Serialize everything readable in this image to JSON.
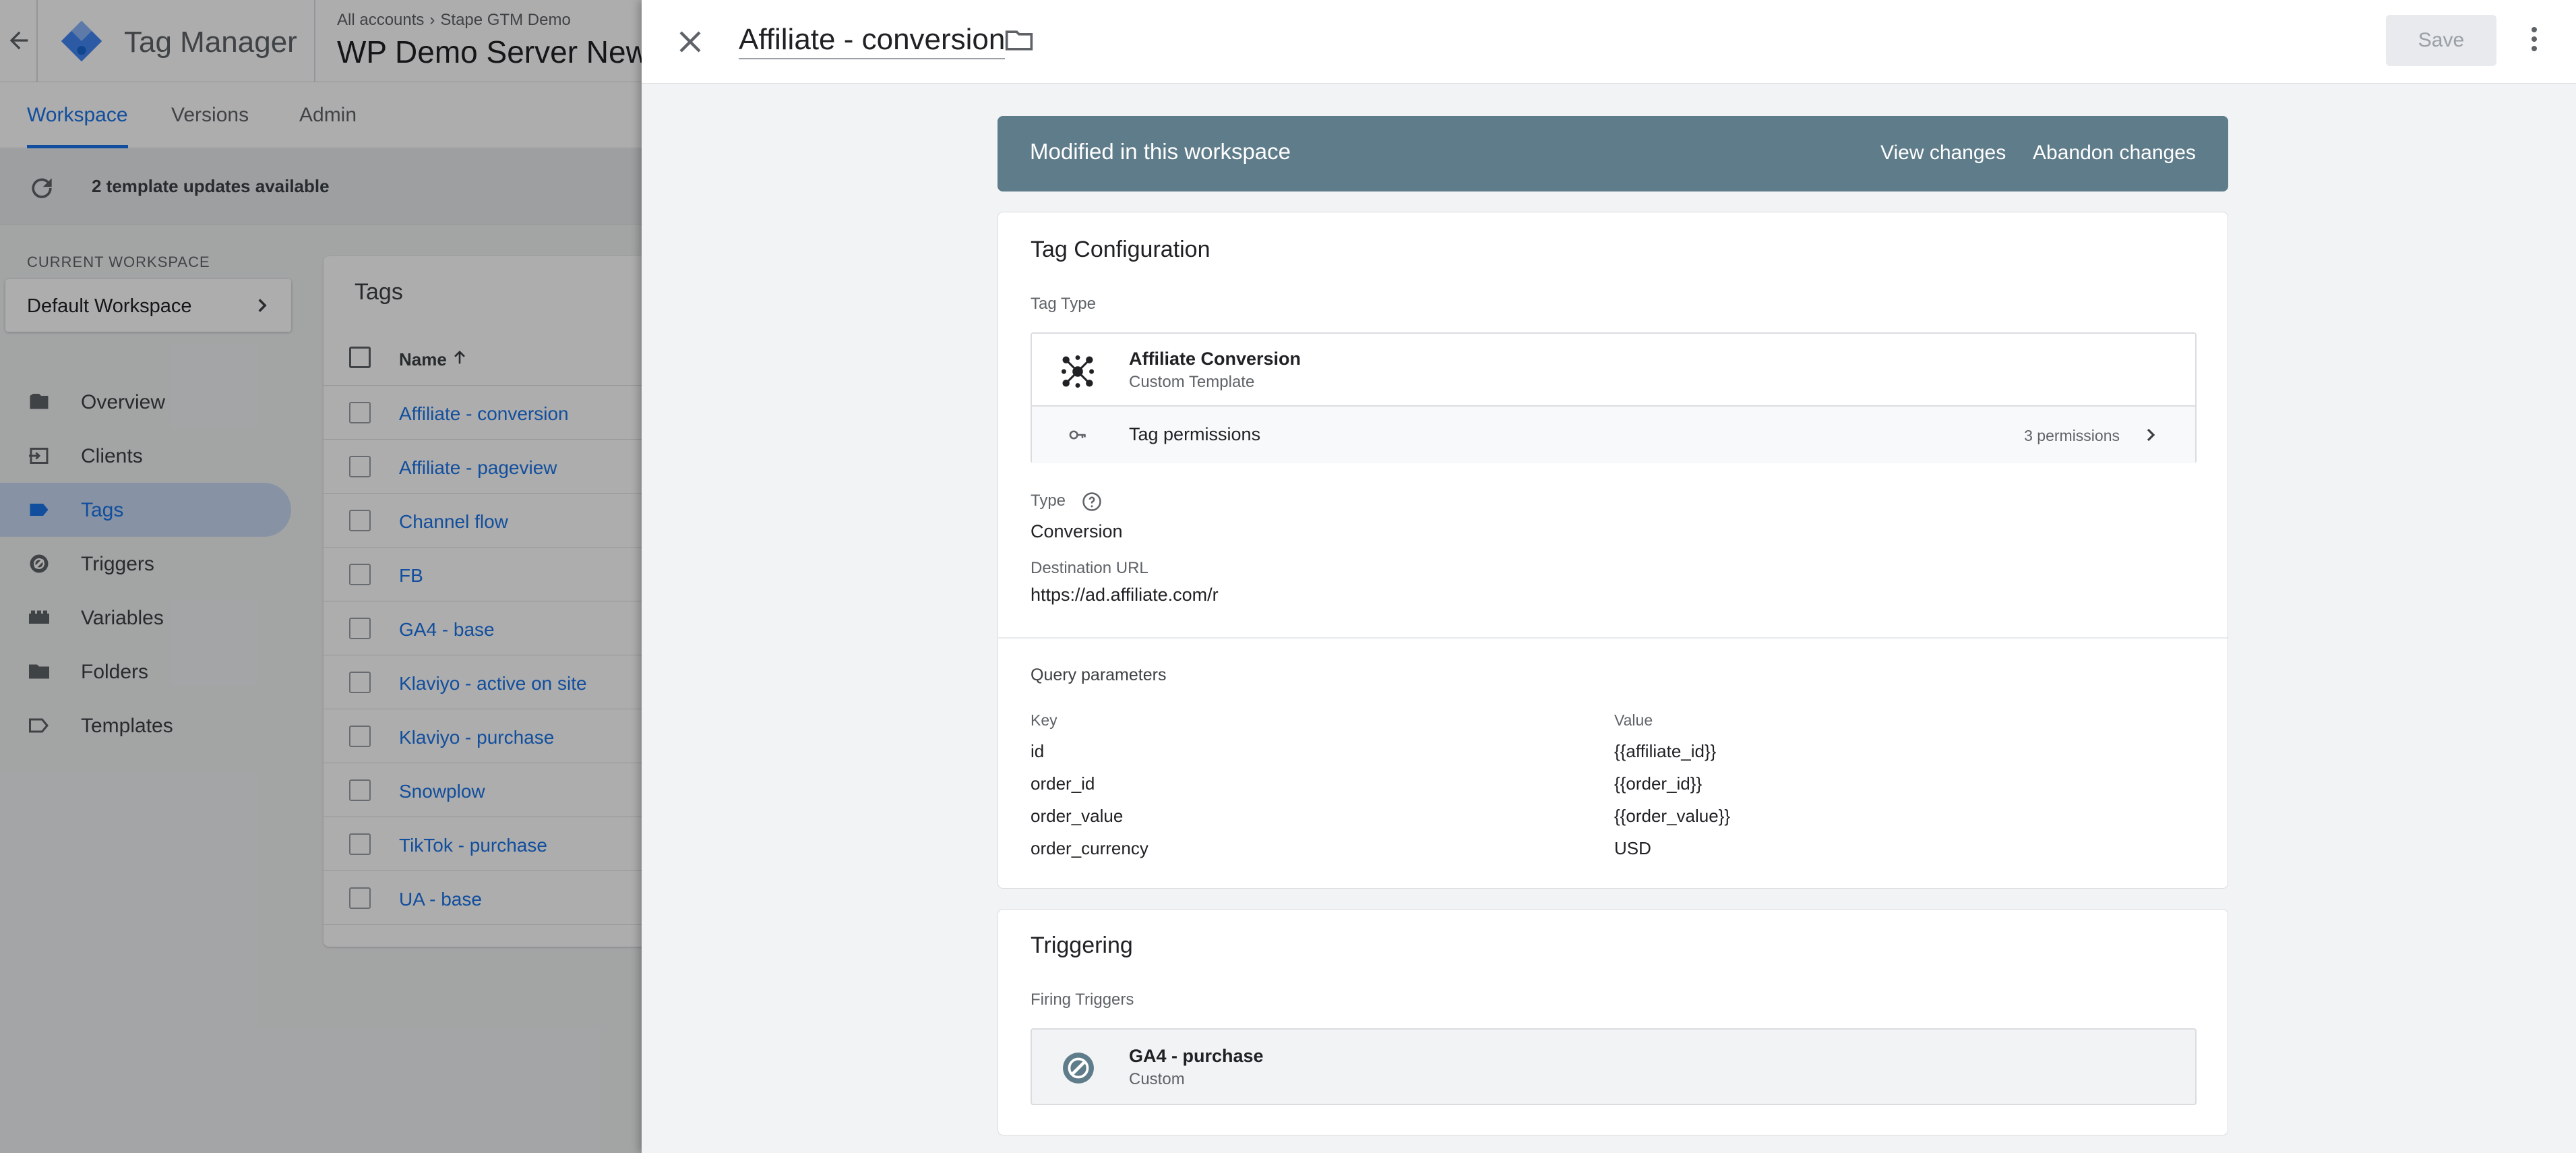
{
  "app": {
    "name": "Tag Manager",
    "breadcrumb": {
      "account": "All accounts",
      "container_path": "Stape GTM Demo"
    },
    "container_name": "WP Demo Server New"
  },
  "nav_tabs": [
    {
      "label": "Workspace",
      "active": true
    },
    {
      "label": "Versions",
      "active": false
    },
    {
      "label": "Admin",
      "active": false
    }
  ],
  "updates_banner": {
    "text": "2 template updates available"
  },
  "workspace": {
    "label": "CURRENT WORKSPACE",
    "name": "Default Workspace"
  },
  "sidenav": [
    {
      "label": "Overview",
      "icon": "overview-icon",
      "active": false
    },
    {
      "label": "Clients",
      "icon": "clients-icon",
      "active": false
    },
    {
      "label": "Tags",
      "icon": "tag-icon",
      "active": true
    },
    {
      "label": "Triggers",
      "icon": "trigger-icon",
      "active": false
    },
    {
      "label": "Variables",
      "icon": "variables-icon",
      "active": false
    },
    {
      "label": "Folders",
      "icon": "folder-icon",
      "active": false
    },
    {
      "label": "Templates",
      "icon": "template-icon",
      "active": false
    }
  ],
  "tags_list": {
    "title": "Tags",
    "column_name": "Name",
    "rows": [
      "Affiliate - conversion",
      "Affiliate - pageview",
      "Channel flow",
      "FB",
      "GA4 - base",
      "Klaviyo - active on site",
      "Klaviyo - purchase",
      "Snowplow",
      "TikTok - purchase",
      "UA - base"
    ]
  },
  "panel": {
    "title": "Affiliate - conversion",
    "save_label": "Save",
    "banner": {
      "message": "Modified in this workspace",
      "view_changes": "View changes",
      "abandon_changes": "Abandon changes"
    },
    "tag_config": {
      "title": "Tag Configuration",
      "tag_type_label": "Tag Type",
      "tag_type_name": "Affiliate Conversion",
      "tag_type_sub": "Custom Template",
      "permissions_label": "Tag permissions",
      "permissions_count": "3 permissions",
      "type_label": "Type",
      "type_value": "Conversion",
      "dest_label": "Destination URL",
      "dest_value": "https://ad.affiliate.com/r",
      "query_title": "Query parameters",
      "key_header": "Key",
      "value_header": "Value",
      "params": [
        {
          "key": "id",
          "value": "{{affiliate_id}}"
        },
        {
          "key": "order_id",
          "value": "{{order_id}}"
        },
        {
          "key": "order_value",
          "value": "{{order_value}}"
        },
        {
          "key": "order_currency",
          "value": "USD"
        }
      ]
    },
    "triggering": {
      "title": "Triggering",
      "firing_label": "Firing Triggers",
      "trigger_name": "GA4 - purchase",
      "trigger_sub": "Custom"
    }
  },
  "colors": {
    "accent": "#1a73e8",
    "banner": "#5f7c8a",
    "active_nav_bg": "#c8d9f3"
  }
}
